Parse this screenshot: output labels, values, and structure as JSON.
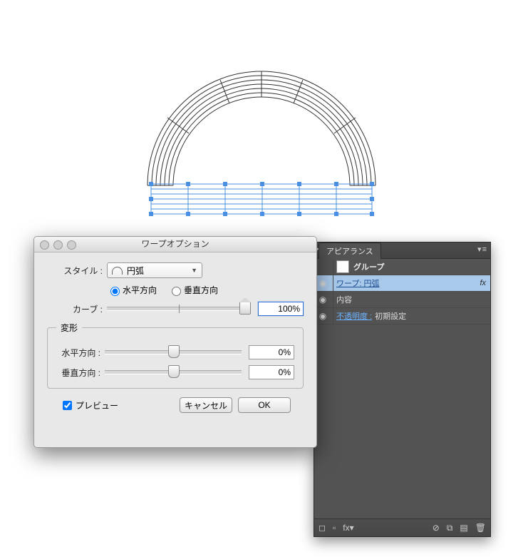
{
  "dialog": {
    "title": "ワープオプション",
    "style_label": "スタイル :",
    "style_value": "円弧",
    "orient_h": "水平方向",
    "orient_v": "垂直方向",
    "curve_label": "カーブ :",
    "curve_value": "100%",
    "distort_legend": "変形",
    "dist_h_label": "水平方向 :",
    "dist_h_value": "0%",
    "dist_v_label": "垂直方向 :",
    "dist_v_value": "0%",
    "preview_label": "プレビュー",
    "cancel": "キャンセル",
    "ok": "OK"
  },
  "panel": {
    "tab": "アピアランス",
    "group": "グループ",
    "warp_label": "ワープ: 円弧",
    "contents": "内容",
    "opacity_label": "不透明度 :",
    "opacity_value": "初期設定",
    "fx": "fx"
  }
}
